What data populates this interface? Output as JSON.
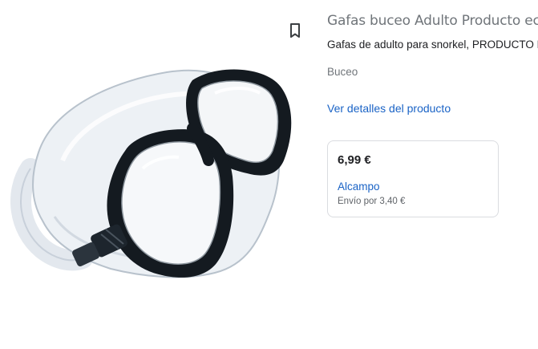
{
  "product": {
    "title": "Gafas buceo Adulto Producto ecológico",
    "subtitle": "Gafas de adulto para snorkel, PRODUCTO ECOLÓGICO",
    "category": "Buceo",
    "details_link": "Ver detalles del producto",
    "image_icon": "diving-mask-image"
  },
  "actions": {
    "bookmark_icon": "bookmark-icon"
  },
  "offer": {
    "price": "6,99 €",
    "merchant": "Alcampo",
    "shipping": "Envío por 3,40 €"
  },
  "colors": {
    "link": "#1a63c6",
    "muted": "#70757a",
    "border": "#dadce0"
  }
}
